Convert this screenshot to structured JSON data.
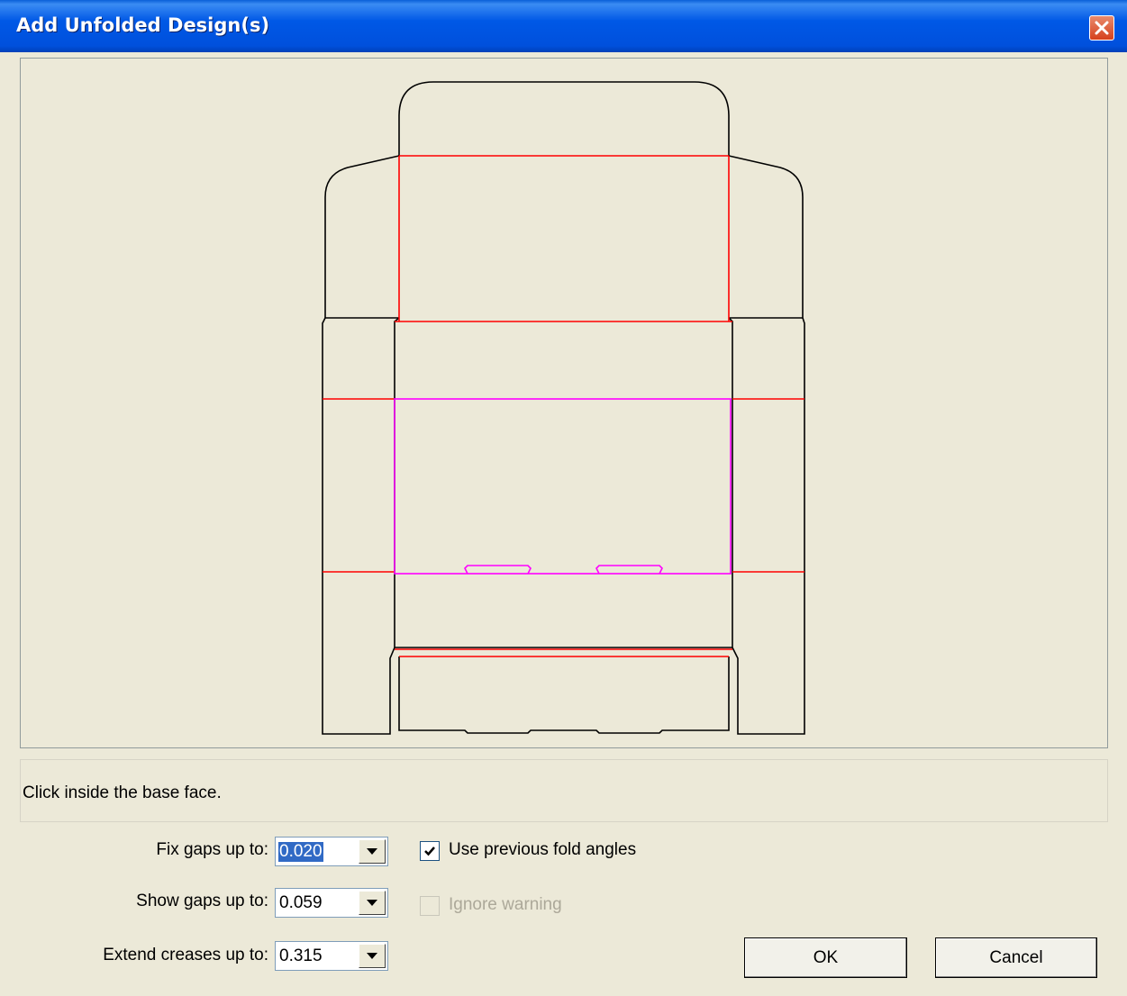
{
  "window": {
    "title": "Add Unfolded Design(s)"
  },
  "status": {
    "message": "Click inside the base face."
  },
  "fields": {
    "fix_gaps": {
      "label": "Fix gaps up to:",
      "value": "0.020"
    },
    "show_gaps": {
      "label": "Show gaps up to:",
      "value": "0.059"
    },
    "extend_creases": {
      "label": "Extend creases up to:",
      "value": "0.315"
    }
  },
  "options": {
    "use_previous_fold_angles": {
      "label": "Use previous fold angles",
      "checked": true,
      "enabled": true
    },
    "ignore_warning": {
      "label": "Ignore warning",
      "checked": false,
      "enabled": false
    }
  },
  "buttons": {
    "ok": "OK",
    "cancel": "Cancel"
  },
  "colors": {
    "cut_line": "#000000",
    "crease_line": "#ff0000",
    "base_face": "#ff00ff",
    "titlebar": "#0058e6"
  },
  "icons": {
    "close": "close-icon",
    "dropdown": "chevron-down-icon",
    "check": "check-icon"
  }
}
